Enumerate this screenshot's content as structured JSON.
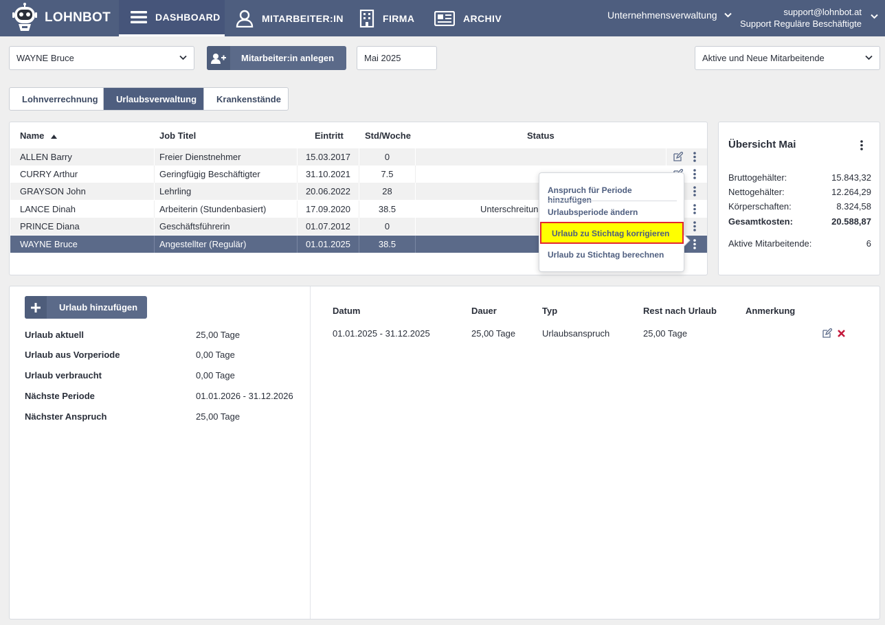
{
  "topbar": {
    "brand": "LOHNBOT",
    "nav": [
      {
        "label": "DASHBOARD",
        "icon": "menu-icon",
        "active": true
      },
      {
        "label": "MITARBEITER:IN",
        "icon": "user-icon",
        "active": false
      },
      {
        "label": "FIRMA",
        "icon": "building-icon",
        "active": false
      },
      {
        "label": "ARCHIV",
        "icon": "newspaper-icon",
        "active": false
      }
    ],
    "company_select": "Unternehmensverwaltung",
    "user_email": "support@lohnbot.at",
    "user_company": "Support Reguläre Beschäftigte"
  },
  "controls": {
    "employee_select": "WAYNE Bruce",
    "add_employee_label": "Mitarbeiter:in anlegen",
    "period": "Mai 2025",
    "filter_select": "Aktive und Neue Mitarbeitende"
  },
  "tabs": [
    {
      "label": "Lohnverrechnung",
      "active": false
    },
    {
      "label": "Urlaubsverwaltung",
      "active": true
    },
    {
      "label": "Krankenstände",
      "active": false
    }
  ],
  "employees": {
    "headers": {
      "name": "Name",
      "job": "Job Titel",
      "entry": "Eintritt",
      "hours": "Std/Woche",
      "status": "Status"
    },
    "rows": [
      {
        "name": "ALLEN Barry",
        "job": "Freier Dienstnehmer",
        "entry": "15.03.2017",
        "hours": "0",
        "status": ""
      },
      {
        "name": "CURRY Arthur",
        "job": "Geringfügig Beschäftigter",
        "entry": "31.10.2021",
        "hours": "7.5",
        "status": ""
      },
      {
        "name": "GRAYSON John",
        "job": "Lehrling",
        "entry": "20.06.2022",
        "hours": "28",
        "status": ""
      },
      {
        "name": "LANCE Dinah",
        "job": "Arbeiterin (Stundenbasiert)",
        "entry": "17.09.2020",
        "hours": "38.5",
        "status": "Unterschreitun"
      },
      {
        "name": "PRINCE Diana",
        "job": "Geschäftsführerin",
        "entry": "01.07.2012",
        "hours": "0",
        "status": ""
      },
      {
        "name": "WAYNE Bruce",
        "job": "Angestellter (Regulär)",
        "entry": "01.01.2025",
        "hours": "38.5",
        "status": ""
      }
    ]
  },
  "context_menu": {
    "items": [
      "Anspruch für Periode hinzufügen",
      "Urlaubsperiode ändern",
      "Urlaub zu Stichtag korrigieren",
      "Urlaub zu Stichtag berechnen"
    ]
  },
  "overview": {
    "title": "Übersicht Mai",
    "rows": [
      {
        "label": "Bruttogehälter:",
        "value": "15.843,32"
      },
      {
        "label": "Nettogehälter:",
        "value": "12.264,29"
      },
      {
        "label": "Körperschaften:",
        "value": "8.324,58"
      },
      {
        "label": "Gesamtkosten:",
        "value": "20.588,87"
      },
      {
        "label": "Aktive Mitarbeitende:",
        "value": "6"
      }
    ]
  },
  "vacation": {
    "add_label": "Urlaub hinzufügen",
    "info": [
      {
        "label": "Urlaub aktuell",
        "value": "25,00 Tage"
      },
      {
        "label": "Urlaub aus Vorperiode",
        "value": "0,00 Tage"
      },
      {
        "label": "Urlaub verbraucht",
        "value": "0,00 Tage"
      },
      {
        "label": "Nächste Periode",
        "value": "01.01.2026 - 31.12.2026"
      },
      {
        "label": "Nächster Anspruch",
        "value": "25,00 Tage"
      }
    ],
    "headers": {
      "date": "Datum",
      "duration": "Dauer",
      "type": "Typ",
      "rest": "Rest nach Urlaub",
      "note": "Anmerkung"
    },
    "rows": [
      {
        "date": "01.01.2025 - 31.12.2025",
        "duration": "25,00 Tage",
        "type": "Urlaubsanspruch",
        "rest": "25,00 Tage",
        "note": ""
      }
    ]
  }
}
